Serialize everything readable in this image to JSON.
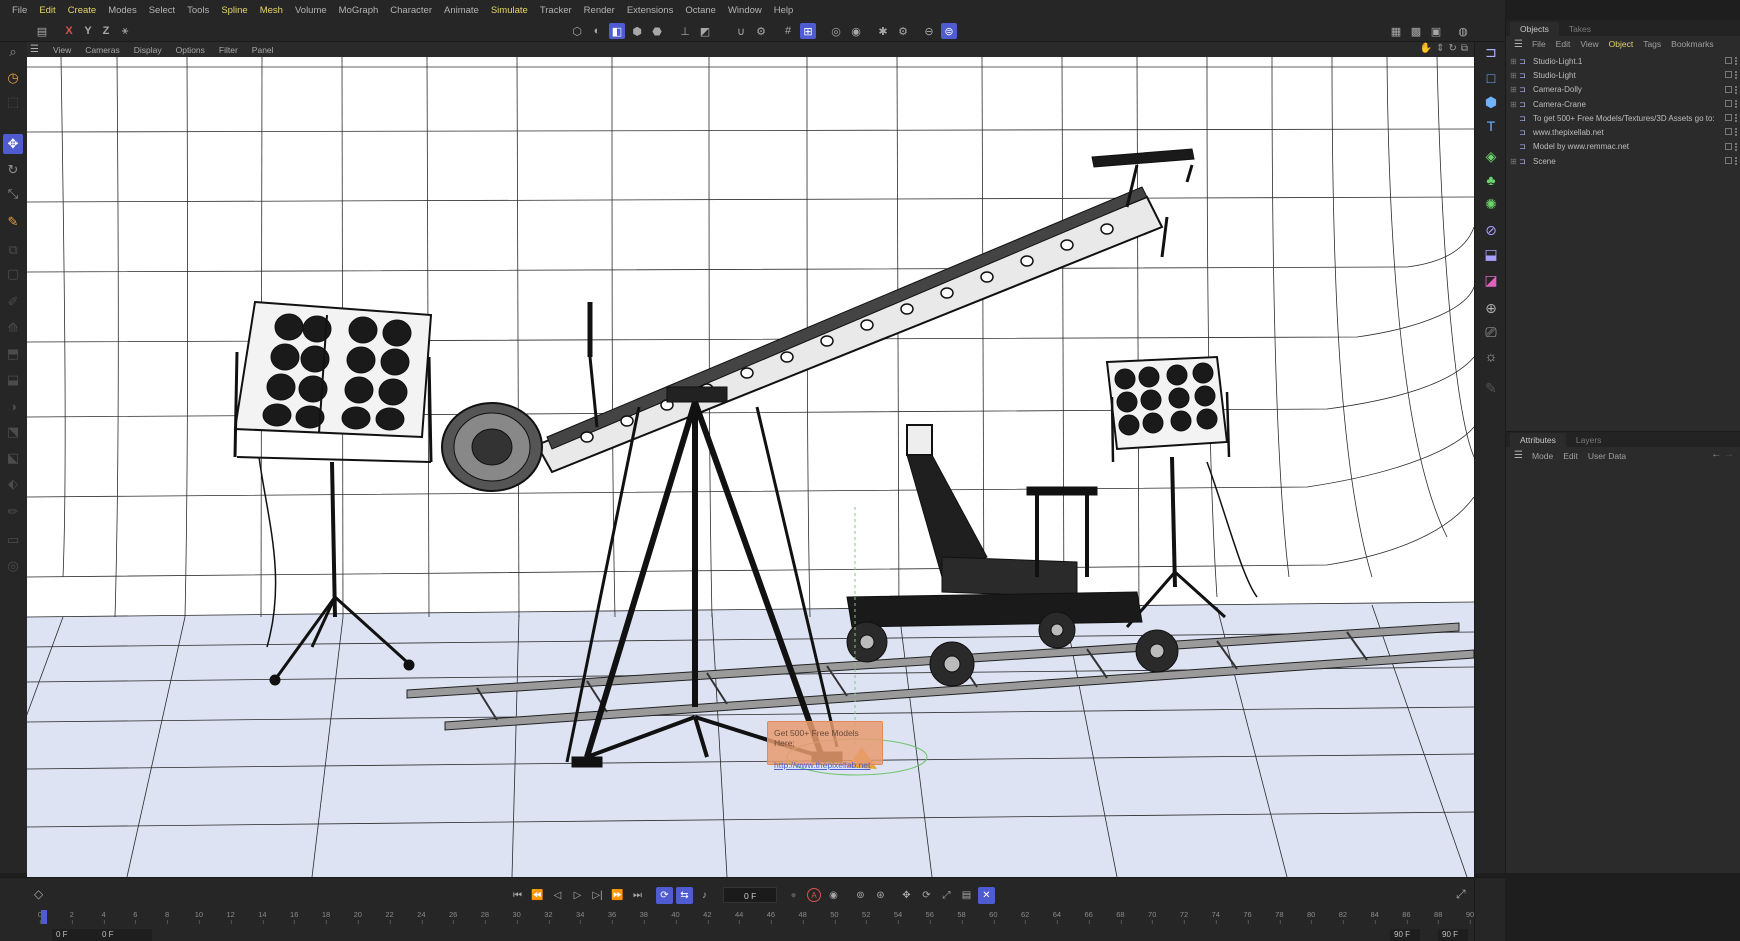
{
  "menu": [
    "File",
    "Edit",
    "Create",
    "Modes",
    "Select",
    "Tools",
    "Spline",
    "Mesh",
    "Volume",
    "MoGraph",
    "Character",
    "Animate",
    "Simulate",
    "Tracker",
    "Render",
    "Extensions",
    "Octane",
    "Window",
    "Help"
  ],
  "menu_highlighted": [
    "Edit",
    "Create",
    "Spline",
    "Mesh",
    "Simulate"
  ],
  "toolbar": {
    "axes": [
      "X",
      "Y",
      "Z"
    ]
  },
  "viewport": {
    "menu": [
      "View",
      "Cameras",
      "Display",
      "Options",
      "Filter",
      "Panel"
    ],
    "overlay": {
      "title": "Get 500+ Free Models Here:",
      "link": "http://www.thepixellab.net"
    }
  },
  "objects_panel": {
    "tabs": [
      "Objects",
      "Takes"
    ],
    "active_tab": "Objects",
    "menu": [
      "File",
      "Edit",
      "View",
      "Object",
      "Tags",
      "Bookmarks"
    ],
    "active_menu": "Object",
    "items": [
      {
        "label": "Studio-Light.1",
        "expandable": true
      },
      {
        "label": "Studio-Light",
        "expandable": true
      },
      {
        "label": "Camera-Dolly",
        "expandable": true
      },
      {
        "label": "Camera-Crane",
        "expandable": true
      },
      {
        "label": "To get 500+ Free Models/Textures/3D Assets go to:",
        "expandable": false
      },
      {
        "label": "www.thepixellab.net",
        "expandable": false
      },
      {
        "label": "Model by www.remmac.net",
        "expandable": false
      },
      {
        "label": "Scene",
        "expandable": true
      }
    ]
  },
  "attributes_panel": {
    "tabs": [
      "Attributes",
      "Layers"
    ],
    "active_tab": "Attributes",
    "menu": [
      "Mode",
      "Edit",
      "User Data"
    ]
  },
  "timeline": {
    "current_frame": "0 F",
    "start_field": "0 F",
    "preview_start": "0 F",
    "preview_end": "90 F",
    "end_field": "90 F",
    "ticks": [
      "0",
      "2",
      "4",
      "6",
      "8",
      "10",
      "12",
      "14",
      "16",
      "18",
      "20",
      "22",
      "24",
      "26",
      "28",
      "30",
      "32",
      "34",
      "36",
      "38",
      "40",
      "42",
      "44",
      "46",
      "48",
      "50",
      "52",
      "54",
      "56",
      "58",
      "60",
      "62",
      "64",
      "66",
      "68",
      "70",
      "72",
      "74",
      "76",
      "78",
      "80",
      "82",
      "84",
      "86",
      "88",
      "90"
    ]
  },
  "colors": {
    "accent": "#4e5bd1",
    "menu_highlight": "#e6d36b",
    "panel_bg": "#2b2b2b",
    "viewport_bg": "#ffffff",
    "floor": "#dde3f3"
  }
}
